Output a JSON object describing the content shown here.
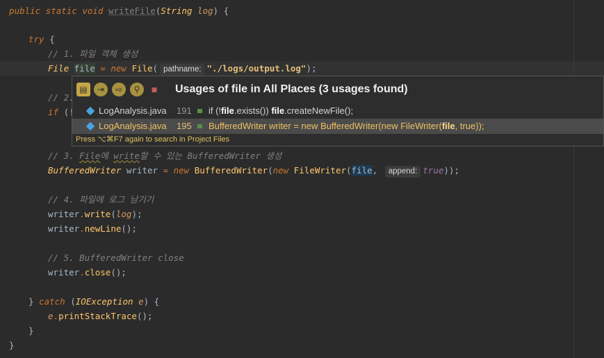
{
  "code": {
    "l1": {
      "kw1": "public",
      "kw2": "static",
      "kw3": "void",
      "method": "writeFile",
      "rest": "(",
      "ptype": "String",
      "pname": "log",
      "end": ") {"
    },
    "l3": {
      "kw": "try",
      "end": " {"
    },
    "l4": {
      "comment": "// 1. 파일 객체 생성"
    },
    "l5": {
      "type": "File",
      "var": "file",
      "op": " = ",
      "kw": "new",
      "cls": "File",
      "open": "(",
      "hint": "pathname:",
      "str": "\"./logs/output.log\"",
      "end": ");"
    },
    "l7": {
      "comment": "// 2."
    },
    "l8": {
      "kw": "if",
      "rest": " (!"
    },
    "l11": {
      "c1": "// 3. ",
      "c2": "File",
      "c3": "에 ",
      "c4": "write",
      "c5": "할 수 있는 BufferedWriter 생성"
    },
    "l12": {
      "type": "BufferedWriter",
      "var": " writer",
      "op": " = ",
      "kw": "new",
      "cls": "BufferedWriter",
      "open": "(",
      "kw2": "new",
      "cls2": "FileWriter",
      "open2": "(",
      "arg": "file",
      "comma": ",",
      "hint": "append:",
      "val": "true",
      "end": "));"
    },
    "l14": {
      "comment": "// 4. 파일에 로그 남기기"
    },
    "l15": {
      "obj": "writer",
      "dot": ".",
      "method": "write",
      "open": "(",
      "arg": "log",
      "end": ");"
    },
    "l16": {
      "obj": "writer",
      "dot": ".",
      "method": "newLine",
      "end": "();"
    },
    "l18": {
      "comment": "// 5. BufferedWriter close"
    },
    "l19": {
      "obj": "writer",
      "dot": ".",
      "method": "close",
      "end": "();"
    },
    "l21": {
      "brace": "} ",
      "kw": "catch",
      "open": " (",
      "type": "IOException",
      "var": "e",
      "end": ") {"
    },
    "l22": {
      "obj": "e",
      "dot": ".",
      "method": "printStackTrace",
      "end": "();"
    },
    "l23": {
      "text": "}"
    },
    "l24": {
      "text": "}"
    }
  },
  "popup": {
    "title": "Usages of file in All Places (3 usages found)",
    "rows": [
      {
        "file": "LogAnalysis.java",
        "line": "191",
        "pre": "if (!",
        "b1": "file",
        "mid": ".exists()) ",
        "b2": "file",
        "post": ".createNewFile();"
      },
      {
        "file": "LogAnalysis.java",
        "line": "195",
        "pre": "BufferedWriter writer = new BufferedWriter(new FileWriter(",
        "b1": "file",
        "post": ", true));"
      }
    ],
    "footer": "Press ⌥⌘F7 again to search in Project Files"
  }
}
